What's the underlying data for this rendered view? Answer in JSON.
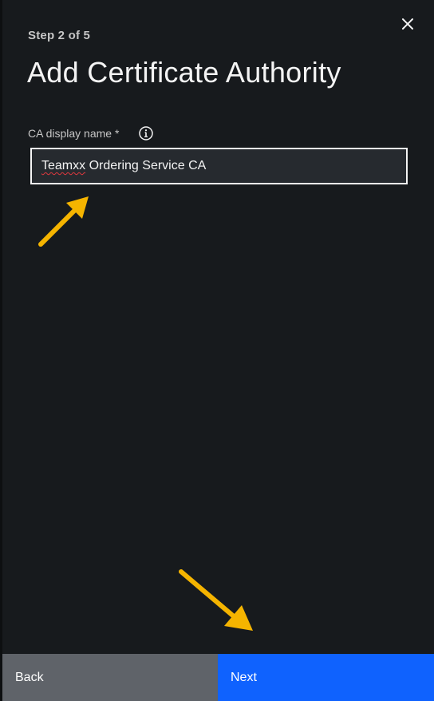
{
  "panel": {
    "step_label": "Step 2 of 5",
    "title": "Add Certificate Authority",
    "close_icon": "close-icon"
  },
  "form": {
    "ca_display_name": {
      "label": "CA display name *",
      "info_icon": "information-icon",
      "value_misspelled_word": "Teamxx",
      "value_rest": " Ordering Service CA"
    }
  },
  "annotations": {
    "arrow_color": "#f5b400"
  },
  "footer": {
    "back_label": "Back",
    "next_label": "Next",
    "back_color": "#5f6369",
    "next_color": "#0f62fe"
  }
}
